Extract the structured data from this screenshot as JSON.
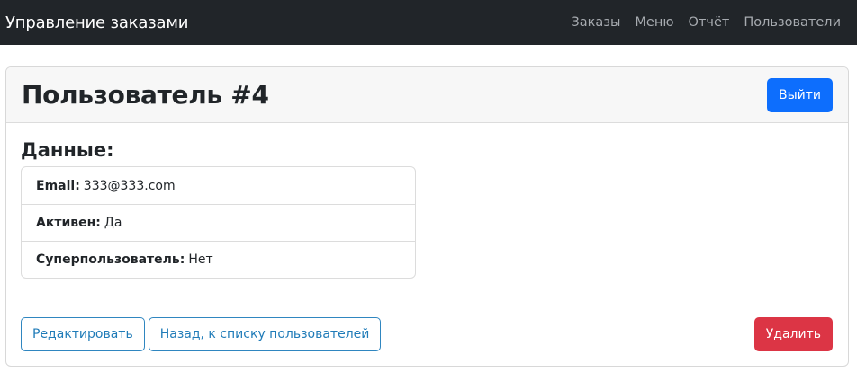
{
  "navbar": {
    "brand": "Управление заказами",
    "links": [
      "Заказы",
      "Меню",
      "Отчёт",
      "Пользователи"
    ]
  },
  "header": {
    "title": "Пользователь #4",
    "logout_label": "Выйти"
  },
  "body": {
    "section_title": "Данные:",
    "fields": [
      {
        "label": "Email:",
        "value": "333@333.com"
      },
      {
        "label": "Активен:",
        "value": "Да"
      },
      {
        "label": "Суперпользователь:",
        "value": "Нет"
      }
    ]
  },
  "actions": {
    "edit_label": "Редактировать",
    "back_label": "Назад, к списку пользователей",
    "delete_label": "Удалить"
  },
  "colors": {
    "navbar_bg": "#212529",
    "primary": "#0d6efd",
    "danger": "#dc3545",
    "outline": "#2f86c0"
  }
}
